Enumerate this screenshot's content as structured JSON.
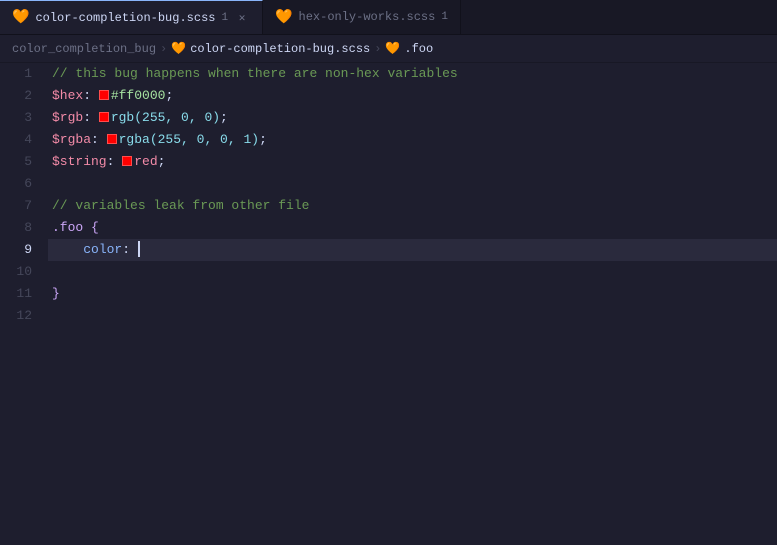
{
  "tabs": [
    {
      "id": "tab1",
      "icon": "scss-icon",
      "label": "color-completion-bug.scss",
      "badge": "1",
      "active": true,
      "closeable": true
    },
    {
      "id": "tab2",
      "icon": "scss-icon",
      "label": "hex-only-works.scss",
      "badge": "1",
      "active": false,
      "closeable": false
    }
  ],
  "breadcrumb": {
    "folder": "color_completion_bug",
    "sep1": ">",
    "file_icon": "scss",
    "file": "color-completion-bug.scss",
    "sep2": ">",
    "selector_icon": "selector",
    "selector": ".foo"
  },
  "lines": [
    {
      "num": "1",
      "content": "comment",
      "text": "// this bug happens when there are non-hex variables",
      "active": false
    },
    {
      "num": "2",
      "content": "var-hex",
      "active": false
    },
    {
      "num": "3",
      "content": "var-rgb",
      "active": false
    },
    {
      "num": "4",
      "content": "var-rgba",
      "active": false
    },
    {
      "num": "5",
      "content": "var-string",
      "active": false
    },
    {
      "num": "6",
      "content": "empty",
      "active": false
    },
    {
      "num": "7",
      "content": "comment2",
      "text": "// variables leak from other file",
      "active": false
    },
    {
      "num": "8",
      "content": "selector",
      "active": false
    },
    {
      "num": "9",
      "content": "color-prop",
      "active": true
    },
    {
      "num": "10",
      "content": "empty2",
      "active": false
    },
    {
      "num": "11",
      "content": "close-brace",
      "active": false
    },
    {
      "num": "12",
      "content": "empty3",
      "active": false
    }
  ],
  "colors": {
    "hex_color": "#ff0000",
    "rgb_color": "rgb(255, 0, 0)",
    "rgba_color": "rgba(255, 0, 0, 1)",
    "string_color": "red",
    "swatch_red": "#ff0000"
  }
}
